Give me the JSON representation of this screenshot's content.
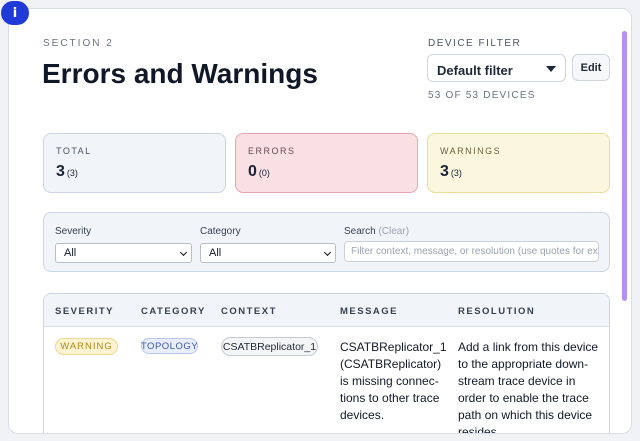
{
  "header": {
    "section_label": "SECTION 2",
    "title": "Errors and Warnings",
    "info_icon_glyph": "i"
  },
  "device_filter": {
    "label": "DEVICE FILTER",
    "selected": "Default filter",
    "edit_label": "Edit",
    "device_count": "53 OF 53 DEVICES"
  },
  "stats": {
    "total": {
      "label": "TOTAL",
      "value": "3",
      "sub": "(3)"
    },
    "errors": {
      "label": "ERRORS",
      "value": "0",
      "sub": "(0)"
    },
    "warnings": {
      "label": "WARNINGS",
      "value": "3",
      "sub": "(3)"
    }
  },
  "filters": {
    "severity": {
      "label": "Severity",
      "selected": "All"
    },
    "category": {
      "label": "Category",
      "selected": "All"
    },
    "search": {
      "label": "Search",
      "clear_label": "(Clear)",
      "placeholder": "Filter context, message, or resolution (use quotes for exac"
    }
  },
  "table": {
    "columns": [
      "SEVERITY",
      "CATEGORY",
      "CONTEXT",
      "MESSAGE",
      "RESOLUTION"
    ],
    "rows": [
      {
        "severity": "WARNING",
        "category": "TOPOLOGY",
        "context": "CSATBReplicator_1",
        "message": "CSATBReplicator_1 (CSATBReplicator) is missing connec­tions to other trace devices.",
        "resolution": "Add a link from this device to the appropriate down­stream trace device in order to enable the trace path on which this device resides."
      }
    ]
  },
  "colors": {
    "accent": "#1f3ad6",
    "scrollbar": "#b592f2",
    "error_bg": "#f9e1e3",
    "warning_bg": "#fbf7df"
  },
  "icons": {
    "info": "info-icon",
    "dropdown": "chevron-down-icon"
  }
}
